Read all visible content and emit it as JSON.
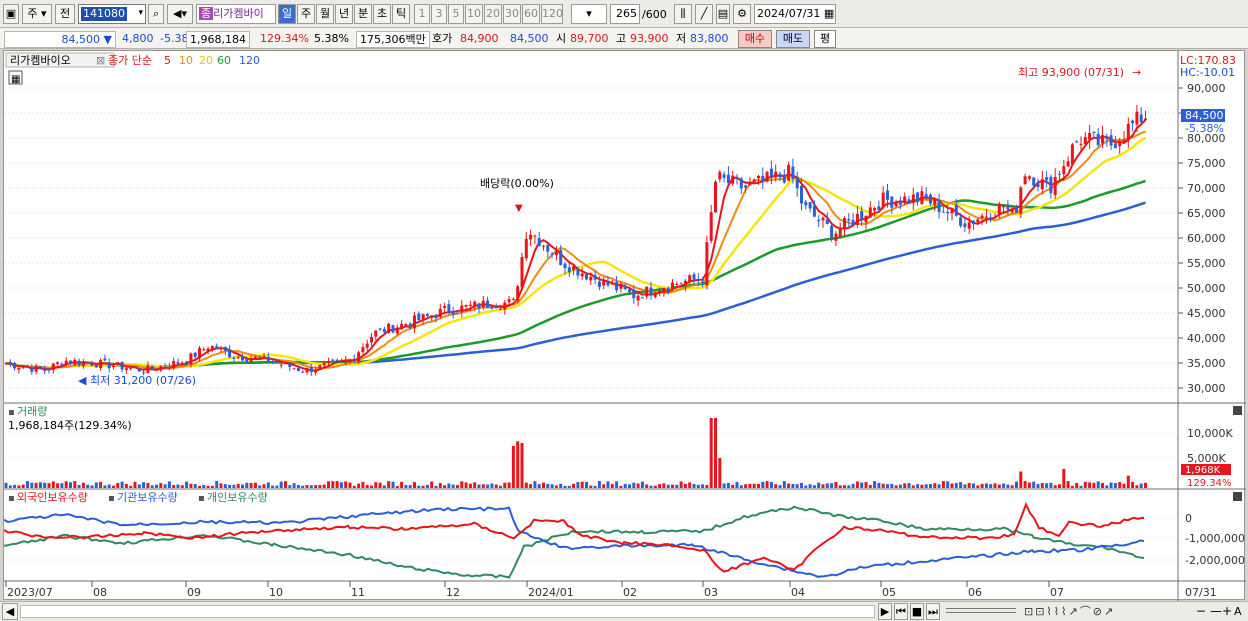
{
  "toolbar": {
    "market": "주",
    "prev": "전",
    "code": "141080",
    "name": "리가켐바이",
    "name_badge": "종",
    "periods": [
      "일",
      "주",
      "월",
      "년",
      "분",
      "초",
      "틱"
    ],
    "selected_period": "일",
    "nums": [
      "1",
      "3",
      "5",
      "10",
      "20",
      "30",
      "60",
      "120"
    ],
    "count": "265",
    "total": "/600",
    "date": "2024/07/31"
  },
  "pricebar": {
    "price": "84,500",
    "change_arrow": "▼",
    "change": "4,800",
    "change_pct": "-5.38%",
    "volume": "1,968,184",
    "volume_ratio": "129.34%",
    "turnover_pct": "5.38%",
    "amount": "175,306백만",
    "quote_label": "호가",
    "ask": "84,900",
    "bid": "84,500",
    "open_label": "시",
    "open": "89,700",
    "high_label": "고",
    "high": "93,900",
    "low_label": "저",
    "low": "83,800",
    "buy": "매수",
    "sell": "매도",
    "eval": "평"
  },
  "price_panel": {
    "title": "리가켐바이오",
    "legend_label": "종가 단순",
    "ma_labels": [
      "5",
      "10",
      "20",
      "60",
      "120"
    ],
    "lc": "LC:170.83",
    "hc": "HC:-10.01",
    "last_price": "84,500",
    "last_pct": "-5.38%",
    "max_label": "최고 93,900 (07/31)",
    "min_label": "최저 31,200 (07/26)",
    "dividend_label": "배당락(0.00%)",
    "y_ticks": [
      "90,000",
      "85,000",
      "80,000",
      "75,000",
      "70,000",
      "65,000",
      "60,000",
      "55,000",
      "50,000",
      "45,000",
      "40,000",
      "35,000",
      "30,000"
    ]
  },
  "volume_panel": {
    "title": "거래량",
    "value": "1,968,184주(129.34%)",
    "y_ticks": [
      "10,000K",
      "5,000K"
    ],
    "last_value": "1,968K",
    "last_pct": "129.34%"
  },
  "holding_panel": {
    "legend": [
      "외국인보유수량",
      "기관보유수량",
      "개인보유수량"
    ],
    "y_ticks": [
      "0",
      "-1,000,000",
      "-2,000,000"
    ]
  },
  "x_axis": [
    "2023/07",
    "08",
    "09",
    "10",
    "11",
    "12",
    "2024/01",
    "02",
    "03",
    "04",
    "05",
    "06",
    "07",
    "07/31"
  ],
  "colors": {
    "up": "#e8151b",
    "down": "#2a5fd6",
    "ma5": "#e8151b",
    "ma10": "#f08a12",
    "ma20": "#f5e50e",
    "ma60": "#1c9a2a",
    "ma120": "#2a5fd6",
    "foreign": "#e8151b",
    "institution": "#2a5fd6",
    "individual": "#2f8a5e"
  },
  "chart_data": {
    "type": "line",
    "title": "리가켐바이오",
    "series": [
      {
        "name": "종가",
        "x": [
          "2023/07",
          "2023/08",
          "2023/09",
          "2023/10",
          "2023/11",
          "2023/12",
          "2024/01",
          "2024/02",
          "2024/03",
          "2024/04",
          "2024/05",
          "2024/06",
          "2024/07",
          "07/31"
        ],
        "values": [
          33500,
          35500,
          38500,
          34500,
          41000,
          47000,
          60000,
          50000,
          76000,
          63000,
          68000,
          64000,
          80000,
          84500
        ]
      }
    ],
    "ylim": [
      27000,
      95000
    ],
    "high": 93900,
    "low": 31200
  }
}
